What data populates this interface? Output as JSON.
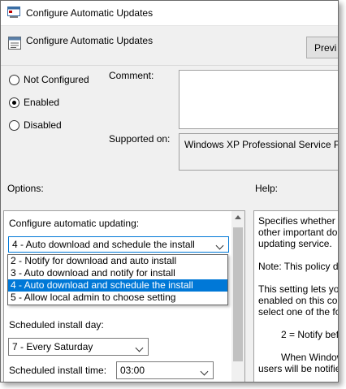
{
  "window": {
    "title": "Configure Automatic Updates"
  },
  "header": {
    "title": "Configure Automatic Updates",
    "previous_button": "Previ"
  },
  "state_options": [
    {
      "label": "Not Configured",
      "checked": false
    },
    {
      "label": "Enabled",
      "checked": true
    },
    {
      "label": "Disabled",
      "checked": false
    }
  ],
  "comment": {
    "label": "Comment:",
    "value": ""
  },
  "supported": {
    "label": "Supported on:",
    "value": "Windows XP Professional Service Pac"
  },
  "sections": {
    "options_label": "Options:",
    "help_label": "Help:"
  },
  "options": {
    "configure_label": "Configure automatic updating:",
    "configure_value": "4 - Auto download and schedule the install",
    "configure_choices": [
      "2 - Notify for download and auto install",
      "3 - Auto download and notify for install",
      "4 - Auto download and schedule the install",
      "5 - Allow local admin to choose setting"
    ],
    "selected_index": 2,
    "day_label": "Scheduled install day:",
    "day_value": "7 - Every Saturday",
    "time_label": "Scheduled install time:",
    "time_value": "03:00"
  },
  "help": {
    "para1": [
      "Specifies whether t",
      "other important do",
      "updating service."
    ],
    "para2": [
      "Note: This policy do"
    ],
    "para3": [
      "This setting lets you",
      "enabled on this com",
      "select one of the fo"
    ],
    "para4": [
      "2 = Notify befo"
    ],
    "para5": [
      "When Window",
      "users will be notifie"
    ]
  },
  "colors": {
    "accent": "#0078d7",
    "window_bg": "#f0f0f0"
  }
}
